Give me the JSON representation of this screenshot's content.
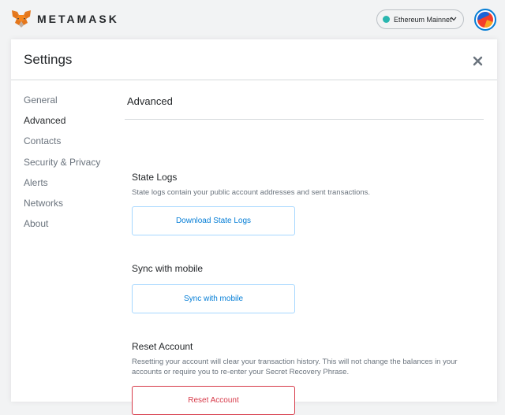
{
  "app": {
    "brand": "METAMASK",
    "logo_icon": "fox-logo-icon"
  },
  "network": {
    "label": "Ethereum Mainnet",
    "status_color": "#29b6af"
  },
  "account": {
    "avatar_icon": "account-identicon"
  },
  "settings": {
    "title": "Settings",
    "close_icon": "close-icon",
    "nav": [
      {
        "label": "General",
        "active": false
      },
      {
        "label": "Advanced",
        "active": true
      },
      {
        "label": "Contacts",
        "active": false
      },
      {
        "label": "Security & Privacy",
        "active": false
      },
      {
        "label": "Alerts",
        "active": false
      },
      {
        "label": "Networks",
        "active": false
      },
      {
        "label": "About",
        "active": false
      }
    ],
    "content_title": "Advanced",
    "sections": {
      "state_logs": {
        "title": "State Logs",
        "description": "State logs contain your public account addresses and sent transactions.",
        "button": "Download State Logs"
      },
      "sync": {
        "title": "Sync with mobile",
        "button": "Sync with mobile"
      },
      "reset": {
        "title": "Reset Account",
        "description": "Resetting your account will clear your transaction history. This will not change the balances in your accounts or require you to re-enter your Secret Recovery Phrase.",
        "button": "Reset Account"
      }
    }
  },
  "colors": {
    "accent_blue": "#037dd6",
    "danger_red": "#d73a49",
    "muted_text": "#6a737d"
  }
}
